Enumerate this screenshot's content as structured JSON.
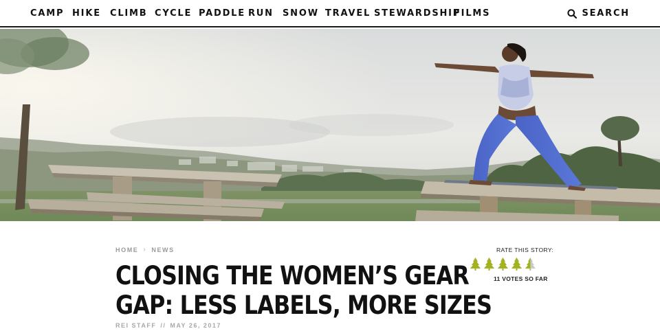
{
  "nav": {
    "items": [
      "CAMP",
      "HIKE",
      "CLIMB",
      "CYCLE",
      "PADDLE",
      "RUN",
      "SNOW",
      "TRAVEL",
      "STEWARDSHIP",
      "FILMS"
    ],
    "search_label": "SEARCH"
  },
  "breadcrumb": {
    "home": "HOME",
    "separator": "›",
    "section": "NEWS"
  },
  "article": {
    "title_line1": "CLOSING THE WOMEN’S GEAR",
    "title_line2": "GAP: LESS LABELS, MORE SIZES",
    "author": "REI STAFF",
    "byline_separator": "//",
    "date": "MAY 26, 2017"
  },
  "rating": {
    "label": "RATE THIS STORY:",
    "value": 4.5,
    "max": 5,
    "votes_text": "11 VOTES SO FAR",
    "active_color": "#a3b21f",
    "inactive_color": "#c9c9c9"
  }
}
